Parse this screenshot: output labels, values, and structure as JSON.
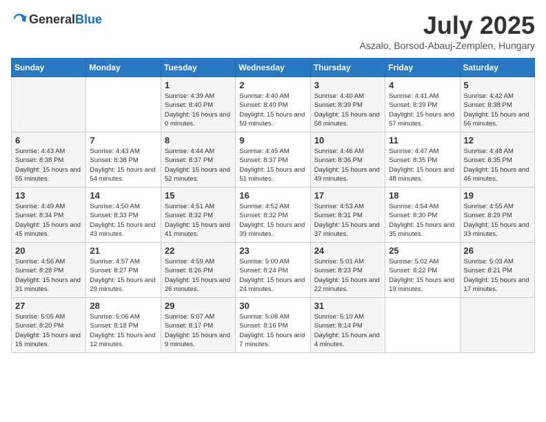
{
  "header": {
    "logo_general": "General",
    "logo_blue": "Blue",
    "month": "July 2025",
    "location": "Aszalo, Borsod-Abauj-Zemplen, Hungary"
  },
  "weekdays": [
    "Sunday",
    "Monday",
    "Tuesday",
    "Wednesday",
    "Thursday",
    "Friday",
    "Saturday"
  ],
  "weeks": [
    [
      {
        "day": "",
        "sunrise": "",
        "sunset": "",
        "daylight": ""
      },
      {
        "day": "",
        "sunrise": "",
        "sunset": "",
        "daylight": ""
      },
      {
        "day": "1",
        "sunrise": "Sunrise: 4:39 AM",
        "sunset": "Sunset: 8:40 PM",
        "daylight": "Daylight: 16 hours and 0 minutes."
      },
      {
        "day": "2",
        "sunrise": "Sunrise: 4:40 AM",
        "sunset": "Sunset: 8:40 PM",
        "daylight": "Daylight: 15 hours and 59 minutes."
      },
      {
        "day": "3",
        "sunrise": "Sunrise: 4:40 AM",
        "sunset": "Sunset: 8:39 PM",
        "daylight": "Daylight: 15 hours and 58 minutes."
      },
      {
        "day": "4",
        "sunrise": "Sunrise: 4:41 AM",
        "sunset": "Sunset: 8:39 PM",
        "daylight": "Daylight: 15 hours and 57 minutes."
      },
      {
        "day": "5",
        "sunrise": "Sunrise: 4:42 AM",
        "sunset": "Sunset: 8:38 PM",
        "daylight": "Daylight: 15 hours and 56 minutes."
      }
    ],
    [
      {
        "day": "6",
        "sunrise": "Sunrise: 4:43 AM",
        "sunset": "Sunset: 8:38 PM",
        "daylight": "Daylight: 15 hours and 55 minutes."
      },
      {
        "day": "7",
        "sunrise": "Sunrise: 4:43 AM",
        "sunset": "Sunset: 8:38 PM",
        "daylight": "Daylight: 15 hours and 54 minutes."
      },
      {
        "day": "8",
        "sunrise": "Sunrise: 4:44 AM",
        "sunset": "Sunset: 8:37 PM",
        "daylight": "Daylight: 15 hours and 52 minutes."
      },
      {
        "day": "9",
        "sunrise": "Sunrise: 4:45 AM",
        "sunset": "Sunset: 8:37 PM",
        "daylight": "Daylight: 15 hours and 51 minutes."
      },
      {
        "day": "10",
        "sunrise": "Sunrise: 4:46 AM",
        "sunset": "Sunset: 8:36 PM",
        "daylight": "Daylight: 15 hours and 49 minutes."
      },
      {
        "day": "11",
        "sunrise": "Sunrise: 4:47 AM",
        "sunset": "Sunset: 8:35 PM",
        "daylight": "Daylight: 15 hours and 48 minutes."
      },
      {
        "day": "12",
        "sunrise": "Sunrise: 4:48 AM",
        "sunset": "Sunset: 8:35 PM",
        "daylight": "Daylight: 15 hours and 46 minutes."
      }
    ],
    [
      {
        "day": "13",
        "sunrise": "Sunrise: 4:49 AM",
        "sunset": "Sunset: 8:34 PM",
        "daylight": "Daylight: 15 hours and 45 minutes."
      },
      {
        "day": "14",
        "sunrise": "Sunrise: 4:50 AM",
        "sunset": "Sunset: 8:33 PM",
        "daylight": "Daylight: 15 hours and 43 minutes."
      },
      {
        "day": "15",
        "sunrise": "Sunrise: 4:51 AM",
        "sunset": "Sunset: 8:32 PM",
        "daylight": "Daylight: 15 hours and 41 minutes."
      },
      {
        "day": "16",
        "sunrise": "Sunrise: 4:52 AM",
        "sunset": "Sunset: 8:32 PM",
        "daylight": "Daylight: 15 hours and 39 minutes."
      },
      {
        "day": "17",
        "sunrise": "Sunrise: 4:53 AM",
        "sunset": "Sunset: 8:31 PM",
        "daylight": "Daylight: 15 hours and 37 minutes."
      },
      {
        "day": "18",
        "sunrise": "Sunrise: 4:54 AM",
        "sunset": "Sunset: 8:30 PM",
        "daylight": "Daylight: 15 hours and 35 minutes."
      },
      {
        "day": "19",
        "sunrise": "Sunrise: 4:55 AM",
        "sunset": "Sunset: 8:29 PM",
        "daylight": "Daylight: 15 hours and 33 minutes."
      }
    ],
    [
      {
        "day": "20",
        "sunrise": "Sunrise: 4:56 AM",
        "sunset": "Sunset: 8:28 PM",
        "daylight": "Daylight: 15 hours and 31 minutes."
      },
      {
        "day": "21",
        "sunrise": "Sunrise: 4:57 AM",
        "sunset": "Sunset: 8:27 PM",
        "daylight": "Daylight: 15 hours and 29 minutes."
      },
      {
        "day": "22",
        "sunrise": "Sunrise: 4:59 AM",
        "sunset": "Sunset: 8:26 PM",
        "daylight": "Daylight: 15 hours and 26 minutes."
      },
      {
        "day": "23",
        "sunrise": "Sunrise: 5:00 AM",
        "sunset": "Sunset: 8:24 PM",
        "daylight": "Daylight: 15 hours and 24 minutes."
      },
      {
        "day": "24",
        "sunrise": "Sunrise: 5:01 AM",
        "sunset": "Sunset: 8:23 PM",
        "daylight": "Daylight: 15 hours and 22 minutes."
      },
      {
        "day": "25",
        "sunrise": "Sunrise: 5:02 AM",
        "sunset": "Sunset: 8:22 PM",
        "daylight": "Daylight: 15 hours and 19 minutes."
      },
      {
        "day": "26",
        "sunrise": "Sunrise: 5:03 AM",
        "sunset": "Sunset: 8:21 PM",
        "daylight": "Daylight: 15 hours and 17 minutes."
      }
    ],
    [
      {
        "day": "27",
        "sunrise": "Sunrise: 5:05 AM",
        "sunset": "Sunset: 8:20 PM",
        "daylight": "Daylight: 15 hours and 15 minutes."
      },
      {
        "day": "28",
        "sunrise": "Sunrise: 5:06 AM",
        "sunset": "Sunset: 8:18 PM",
        "daylight": "Daylight: 15 hours and 12 minutes."
      },
      {
        "day": "29",
        "sunrise": "Sunrise: 5:07 AM",
        "sunset": "Sunset: 8:17 PM",
        "daylight": "Daylight: 15 hours and 9 minutes."
      },
      {
        "day": "30",
        "sunrise": "Sunrise: 5:08 AM",
        "sunset": "Sunset: 8:16 PM",
        "daylight": "Daylight: 15 hours and 7 minutes."
      },
      {
        "day": "31",
        "sunrise": "Sunrise: 5:10 AM",
        "sunset": "Sunset: 8:14 PM",
        "daylight": "Daylight: 15 hours and 4 minutes."
      },
      {
        "day": "",
        "sunrise": "",
        "sunset": "",
        "daylight": ""
      },
      {
        "day": "",
        "sunrise": "",
        "sunset": "",
        "daylight": ""
      }
    ]
  ]
}
